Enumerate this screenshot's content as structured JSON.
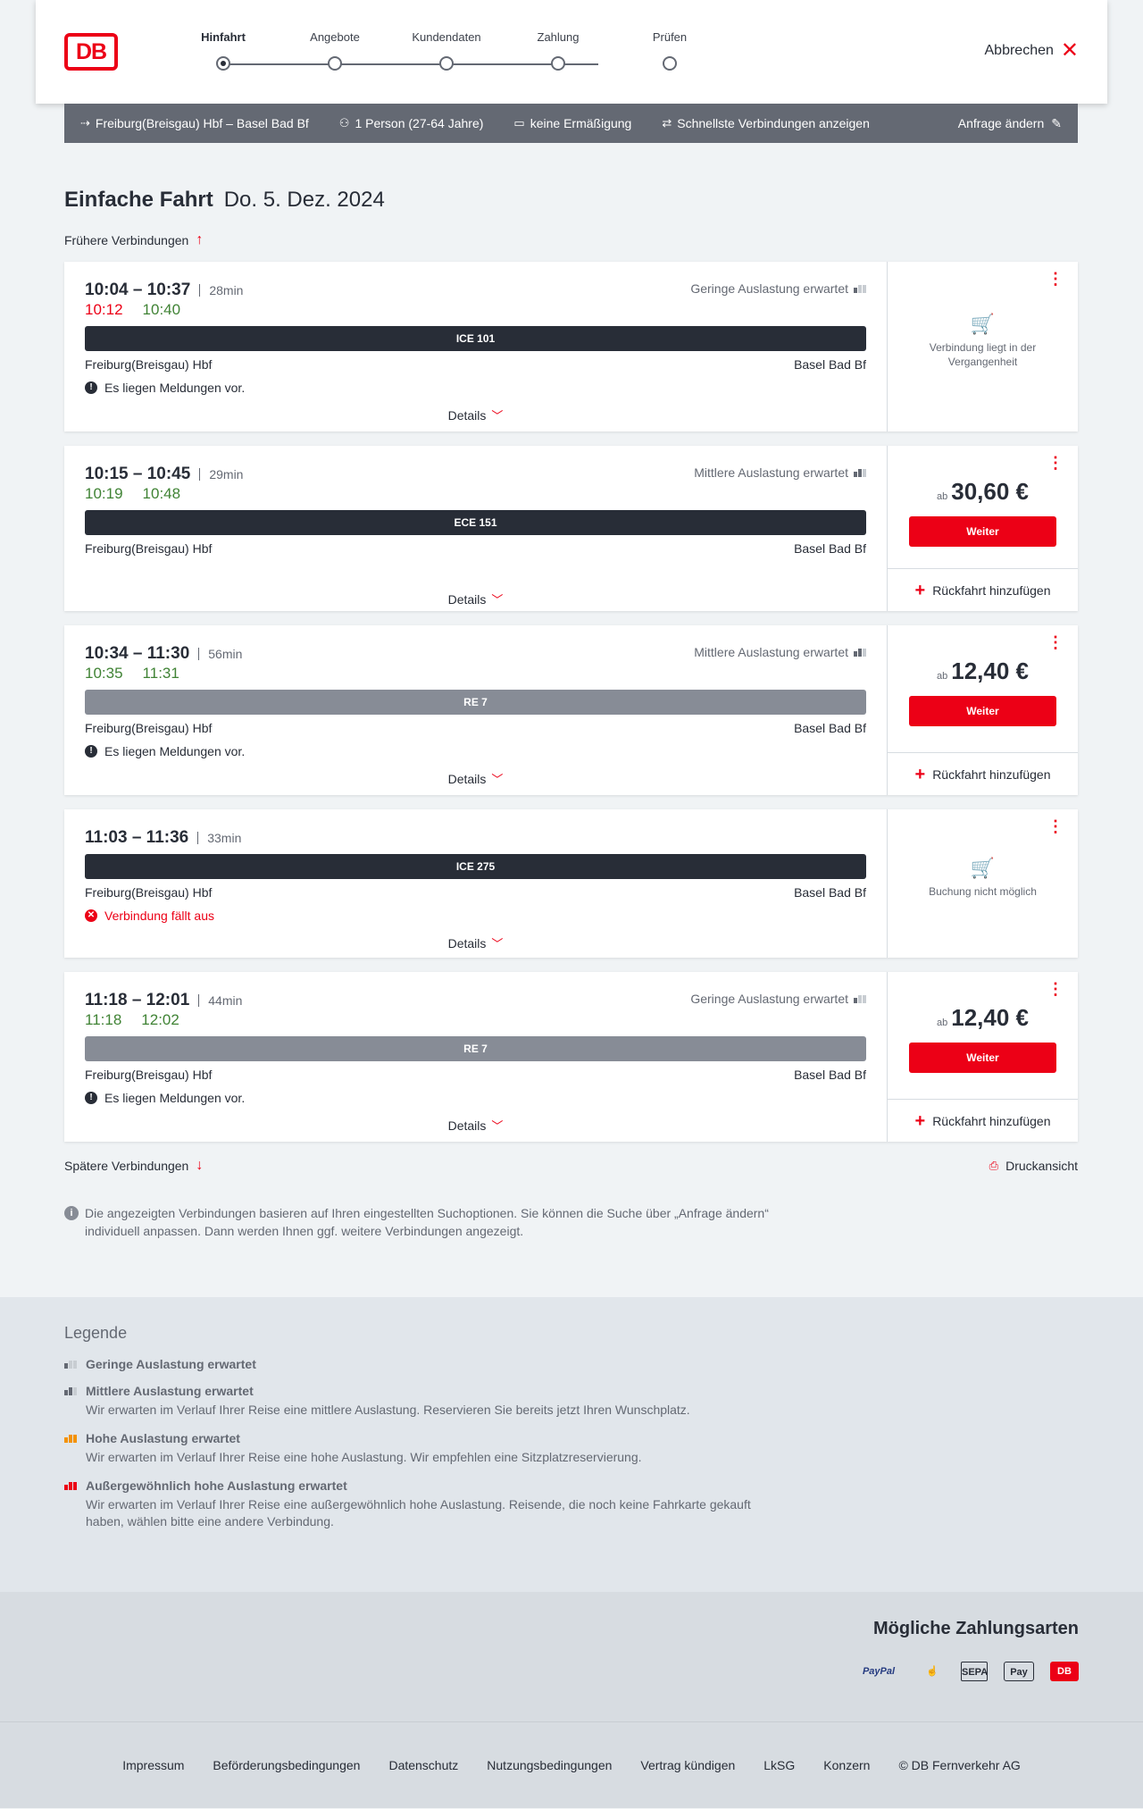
{
  "header": {
    "logo": "DB",
    "steps": [
      "Hinfahrt",
      "Angebote",
      "Kundendaten",
      "Zahlung",
      "Prüfen"
    ],
    "active_step": 0,
    "cancel_label": "Abbrechen"
  },
  "search": {
    "route": "Freiburg(Breisgau) Hbf – Basel Bad Bf",
    "passengers": "1 Person (27-64 Jahre)",
    "discount": "keine Ermäßigung",
    "fastest": "Schnellste Verbindungen anzeigen",
    "edit": "Anfrage ändern"
  },
  "page": {
    "title": "Einfache Fahrt",
    "date": "Do. 5. Dez. 2024",
    "earlier": "Frühere Verbindungen",
    "later": "Spätere Verbindungen",
    "print": "Druckansicht",
    "note": "Die angezeigten Verbindungen basieren auf Ihren eingestellten Suchoptionen. Sie können die Suche über „Anfrage ändern“ individuell anpassen. Dann werden Ihnen ggf. weitere Verbindungen angezeigt."
  },
  "connections": [
    {
      "times": "10:04 – 10:37",
      "duration": "28min",
      "rt_dep": "10:12",
      "rt_arr": "10:40",
      "dep_late": true,
      "load": "Geringe Auslastung erwartet",
      "load_level": 1,
      "train": "ICE 101",
      "train_type": "ice",
      "from": "Freiburg(Breisgau) Hbf",
      "to": "Basel Bad Bf",
      "message": "Es liegen Meldungen vor.",
      "message_type": "info",
      "details": "Details",
      "status": "Verbindung liegt in der Vergangenheit"
    },
    {
      "times": "10:15 – 10:45",
      "duration": "29min",
      "rt_dep": "10:19",
      "rt_arr": "10:48",
      "dep_late": false,
      "load": "Mittlere Auslastung erwartet",
      "load_level": 2,
      "train": "ECE 151",
      "train_type": "ice",
      "from": "Freiburg(Breisgau) Hbf",
      "to": "Basel Bad Bf",
      "details": "Details",
      "price_prefix": "ab",
      "price": "30,60 €",
      "button": "Weiter",
      "return": "Rückfahrt hinzufügen"
    },
    {
      "times": "10:34 – 11:30",
      "duration": "56min",
      "rt_dep": "10:35",
      "rt_arr": "11:31",
      "dep_late": false,
      "load": "Mittlere Auslastung erwartet",
      "load_level": 2,
      "train": "RE 7",
      "train_type": "re",
      "from": "Freiburg(Breisgau) Hbf",
      "to": "Basel Bad Bf",
      "message": "Es liegen Meldungen vor.",
      "message_type": "info",
      "details": "Details",
      "price_prefix": "ab",
      "price": "12,40 €",
      "button": "Weiter",
      "return": "Rückfahrt hinzufügen"
    },
    {
      "times": "11:03 – 11:36",
      "duration": "33min",
      "train": "ICE 275",
      "train_type": "ice",
      "from": "Freiburg(Breisgau) Hbf",
      "to": "Basel Bad Bf",
      "message": "Verbindung fällt aus",
      "message_type": "cancel",
      "details": "Details",
      "status": "Buchung nicht möglich"
    },
    {
      "times": "11:18 – 12:01",
      "duration": "44min",
      "rt_dep": "11:18",
      "rt_arr": "12:02",
      "dep_late": false,
      "load": "Geringe Auslastung erwartet",
      "load_level": 1,
      "train": "RE 7",
      "train_type": "re",
      "from": "Freiburg(Breisgau) Hbf",
      "to": "Basel Bad Bf",
      "message": "Es liegen Meldungen vor.",
      "message_type": "info",
      "details": "Details",
      "price_prefix": "ab",
      "price": "12,40 €",
      "button": "Weiter",
      "return": "Rückfahrt hinzufügen"
    }
  ],
  "legend": {
    "title": "Legende",
    "items": [
      {
        "title": "Geringe Auslastung erwartet",
        "desc": "",
        "level": 1,
        "color": "#646973"
      },
      {
        "title": "Mittlere Auslastung erwartet",
        "desc": "Wir erwarten im Verlauf Ihrer Reise eine mittlere Auslastung. Reservieren Sie bereits jetzt Ihren Wunschplatz.",
        "level": 2,
        "color": "#646973"
      },
      {
        "title": "Hohe Auslastung erwartet",
        "desc": "Wir erwarten im Verlauf Ihrer Reise eine hohe Auslastung. Wir empfehlen eine Sitzplatzreservierung.",
        "level": 3,
        "color": "#f39200"
      },
      {
        "title": "Außergewöhnlich hohe Auslastung erwartet",
        "desc": "Wir erwarten im Verlauf Ihrer Reise eine außergewöhnlich hohe Auslastung. Reisende, die noch keine Fahrkarte gekauft haben, wählen bitte eine andere Verbindung.",
        "level": 4,
        "color": "#ec0016"
      }
    ]
  },
  "payment": {
    "title": "Mögliche Zahlungsarten",
    "icons": [
      "PayPal",
      "SEPA",
      "Pay",
      "DB"
    ]
  },
  "footer": {
    "links": [
      "Impressum",
      "Beförderungsbedingungen",
      "Datenschutz",
      "Nutzungsbedingungen",
      "Vertrag kündigen",
      "LkSG",
      "Konzern",
      "© DB Fernverkehr AG"
    ]
  }
}
